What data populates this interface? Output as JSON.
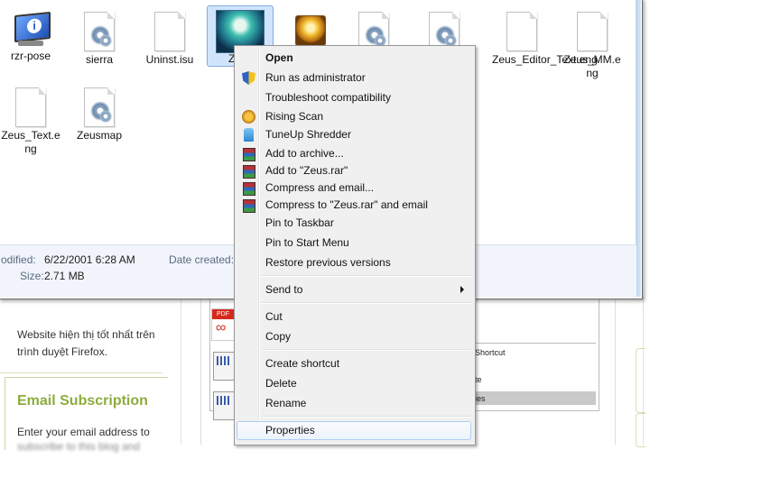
{
  "webpage": {
    "left_text": "Website hiện thị tốt nhất trên trình duyệt Firefox.",
    "email_title": "Email Subscription",
    "email_text": "Enter your email address to",
    "email_text_blurred": "subscribe to this blog and",
    "inner_items": [
      "Shortcut",
      "te",
      "ies"
    ],
    "pdf_badge": "PDF"
  },
  "files": [
    {
      "label": "rzr-pose",
      "icon": "monitor-info-icon"
    },
    {
      "label": "sierra",
      "icon": "config-file-icon"
    },
    {
      "label": "Uninst.isu",
      "icon": "blank-file-icon"
    },
    {
      "label": "Zeus",
      "icon": "zeus-app-icon"
    },
    {
      "label": "",
      "icon": "zeus-game-icon"
    },
    {
      "label": "",
      "icon": "config-file-icon"
    },
    {
      "label": "",
      "icon": "config-file-icon"
    },
    {
      "label": "Zeus_Editor_Text.eng",
      "icon": "blank-file-icon"
    },
    {
      "label": "Zeus_MM.eng",
      "icon": "blank-file-icon"
    },
    {
      "label": "Zeus_Text.eng",
      "icon": "blank-file-icon"
    },
    {
      "label": "Zeusmap",
      "icon": "config-file-icon"
    }
  ],
  "details": {
    "modified_label": "odified:",
    "modified_value": "6/22/2001 6:28 AM",
    "size_label": "Size:",
    "size_value": "2.71 MB",
    "created_label": "Date created:"
  },
  "context_menu": {
    "items": [
      {
        "label": "Open",
        "icon": ""
      },
      {
        "label": "Run as administrator",
        "icon": "uac-shield-icon"
      },
      {
        "label": "Troubleshoot compatibility",
        "icon": ""
      },
      {
        "label": "Rising Scan",
        "icon": "rising-lion-icon"
      },
      {
        "label": "TuneUp Shredder",
        "icon": "shredder-icon"
      },
      {
        "label": "Add to archive...",
        "icon": "winrar-icon"
      },
      {
        "label": "Add to \"Zeus.rar\"",
        "icon": "winrar-icon"
      },
      {
        "label": "Compress and email...",
        "icon": "winrar-icon"
      },
      {
        "label": "Compress to \"Zeus.rar\" and email",
        "icon": "winrar-icon"
      },
      {
        "label": "Pin to Taskbar",
        "icon": ""
      },
      {
        "label": "Pin to Start Menu",
        "icon": ""
      },
      {
        "label": "Restore previous versions",
        "icon": ""
      },
      {
        "label": "Send to",
        "icon": "submenu-arrow-icon"
      },
      {
        "label": "Cut",
        "icon": ""
      },
      {
        "label": "Copy",
        "icon": ""
      },
      {
        "label": "Create shortcut",
        "icon": ""
      },
      {
        "label": "Delete",
        "icon": ""
      },
      {
        "label": "Rename",
        "icon": ""
      },
      {
        "label": "Properties",
        "icon": ""
      }
    ],
    "highlighted": "Properties"
  },
  "colors": {
    "selection": "#d0e5fb",
    "menu_bg": "#f0f0f0",
    "accent_green": "#8dac3e"
  }
}
